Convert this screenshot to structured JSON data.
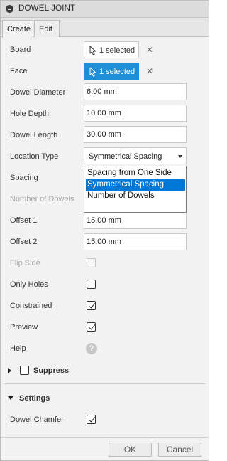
{
  "title": "DOWEL JOINT",
  "tabs": [
    {
      "label": "Create",
      "active": true
    },
    {
      "label": "Edit",
      "active": false
    }
  ],
  "board": {
    "label": "Board",
    "button": "1 selected"
  },
  "face": {
    "label": "Face",
    "button": "1 selected"
  },
  "dowel_diameter": {
    "label": "Dowel Diameter",
    "value": "6.00 mm"
  },
  "hole_depth": {
    "label": "Hole Depth",
    "value": "10.00 mm"
  },
  "dowel_length": {
    "label": "Dowel Length",
    "value": "30.00 mm"
  },
  "location_type": {
    "label": "Location Type",
    "value": "Symmetrical Spacing",
    "options": [
      "Spacing from One Side",
      "Symmetrical Spacing",
      "Number of Dowels"
    ],
    "highlighted_index": 1
  },
  "spacing": {
    "label": "Spacing"
  },
  "number_of_dowels": {
    "label": "Number of Dowels"
  },
  "offset1": {
    "label": "Offset 1",
    "value": "15.00 mm"
  },
  "offset2": {
    "label": "Offset 2",
    "value": "15.00 mm"
  },
  "flip_side": {
    "label": "Flip Side",
    "checked": false,
    "enabled": false
  },
  "only_holes": {
    "label": "Only Holes",
    "checked": false
  },
  "constrained": {
    "label": "Constrained",
    "checked": true
  },
  "preview": {
    "label": "Preview",
    "checked": true
  },
  "help": {
    "label": "Help",
    "icon": "?"
  },
  "suppress": {
    "label": "Suppress",
    "expanded": false,
    "checked": false
  },
  "settings": {
    "label": "Settings",
    "expanded": true
  },
  "dowel_chamfer": {
    "label": "Dowel Chamfer",
    "checked": true
  },
  "footer": {
    "ok_label": "OK",
    "cancel_label": "Cancel"
  },
  "colors": {
    "accent": "#1e8ed6",
    "highlight": "#0078d7"
  }
}
